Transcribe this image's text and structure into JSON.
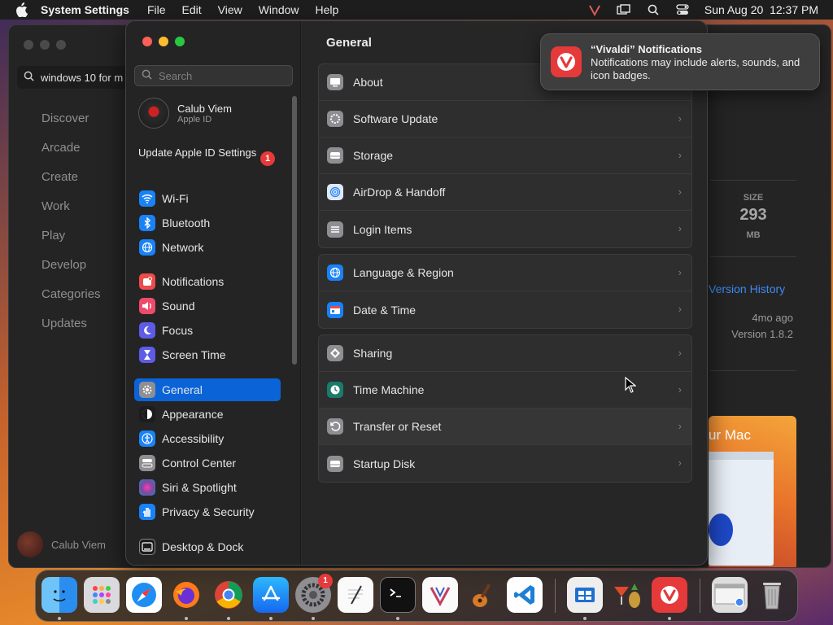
{
  "menubar": {
    "app_name": "System Settings",
    "menus": [
      "File",
      "Edit",
      "View",
      "Window",
      "Help"
    ],
    "clock": "Sun Aug 20  12:37 PM"
  },
  "store": {
    "search_value": "windows 10 for m",
    "nav": [
      "Discover",
      "Arcade",
      "Create",
      "Work",
      "Play",
      "Develop",
      "Categories",
      "Updates"
    ],
    "user_name": "Calub Viem",
    "size_label": "SIZE",
    "size_value": "293",
    "size_unit": "MB",
    "version_history": "Version History",
    "version_ago": "4mo ago",
    "version_num": "Version 1.8.2",
    "promo_text": "ur Mac"
  },
  "settings": {
    "search_placeholder": "Search",
    "user": {
      "name": "Calub Viem",
      "sub": "Apple ID"
    },
    "update": {
      "label": "Update Apple ID Settings",
      "badge": "1"
    },
    "sidebar": [
      {
        "label": "Wi-Fi",
        "icon": "wifi-icon",
        "color": "#1a82f7"
      },
      {
        "label": "Bluetooth",
        "icon": "bluetooth-icon",
        "color": "#1a82f7"
      },
      {
        "label": "Network",
        "icon": "globe-icon",
        "color": "#1a82f7"
      },
      {
        "label": "Notifications",
        "icon": "bell-icon",
        "color": "#ee4b4b"
      },
      {
        "label": "Sound",
        "icon": "speaker-icon",
        "color": "#ee4b6b"
      },
      {
        "label": "Focus",
        "icon": "moon-icon",
        "color": "#5e5ce6"
      },
      {
        "label": "Screen Time",
        "icon": "hourglass-icon",
        "color": "#5e5ce6"
      },
      {
        "label": "General",
        "icon": "gear-icon",
        "color": "#8e8e93",
        "active": true
      },
      {
        "label": "Appearance",
        "icon": "appearance-icon",
        "color": "#1c1c1e"
      },
      {
        "label": "Accessibility",
        "icon": "accessibility-icon",
        "color": "#1a82f7"
      },
      {
        "label": "Control Center",
        "icon": "control-center-icon",
        "color": "#8e8e93"
      },
      {
        "label": "Siri & Spotlight",
        "icon": "siri-icon",
        "color": "#a040c0"
      },
      {
        "label": "Privacy & Security",
        "icon": "hand-icon",
        "color": "#1a82f7"
      },
      {
        "label": "Desktop & Dock",
        "icon": "dock-icon",
        "color": "#1c1c1e"
      }
    ],
    "content_title": "General",
    "groups": [
      [
        {
          "label": "About",
          "icon": "about-icon"
        },
        {
          "label": "Software Update",
          "icon": "software-update-icon"
        },
        {
          "label": "Storage",
          "icon": "storage-icon"
        },
        {
          "label": "AirDrop & Handoff",
          "icon": "airdrop-icon"
        },
        {
          "label": "Login Items",
          "icon": "login-items-icon"
        }
      ],
      [
        {
          "label": "Language & Region",
          "icon": "language-icon"
        },
        {
          "label": "Date & Time",
          "icon": "date-time-icon"
        }
      ],
      [
        {
          "label": "Sharing",
          "icon": "sharing-icon"
        },
        {
          "label": "Time Machine",
          "icon": "time-machine-icon"
        },
        {
          "label": "Transfer or Reset",
          "icon": "transfer-reset-icon"
        },
        {
          "label": "Startup Disk",
          "icon": "startup-disk-icon"
        }
      ]
    ]
  },
  "notification": {
    "title": "“Vivaldi” Notifications",
    "body": "Notifications may include alerts, sounds, and icon badges."
  },
  "dock": {
    "settings_badge": "1",
    "items": [
      "finder-icon",
      "launchpad-icon",
      "safari-icon",
      "firefox-icon",
      "chrome-icon",
      "app-store-icon",
      "system-settings-icon",
      "textedit-icon",
      "terminal-icon",
      "vivaldi-alt-icon",
      "garageband-icon",
      "vscode-icon",
      "windows-app-icon",
      "cocktail-icon",
      "vivaldi-icon",
      "chrome-window-icon",
      "trash-icon"
    ]
  }
}
